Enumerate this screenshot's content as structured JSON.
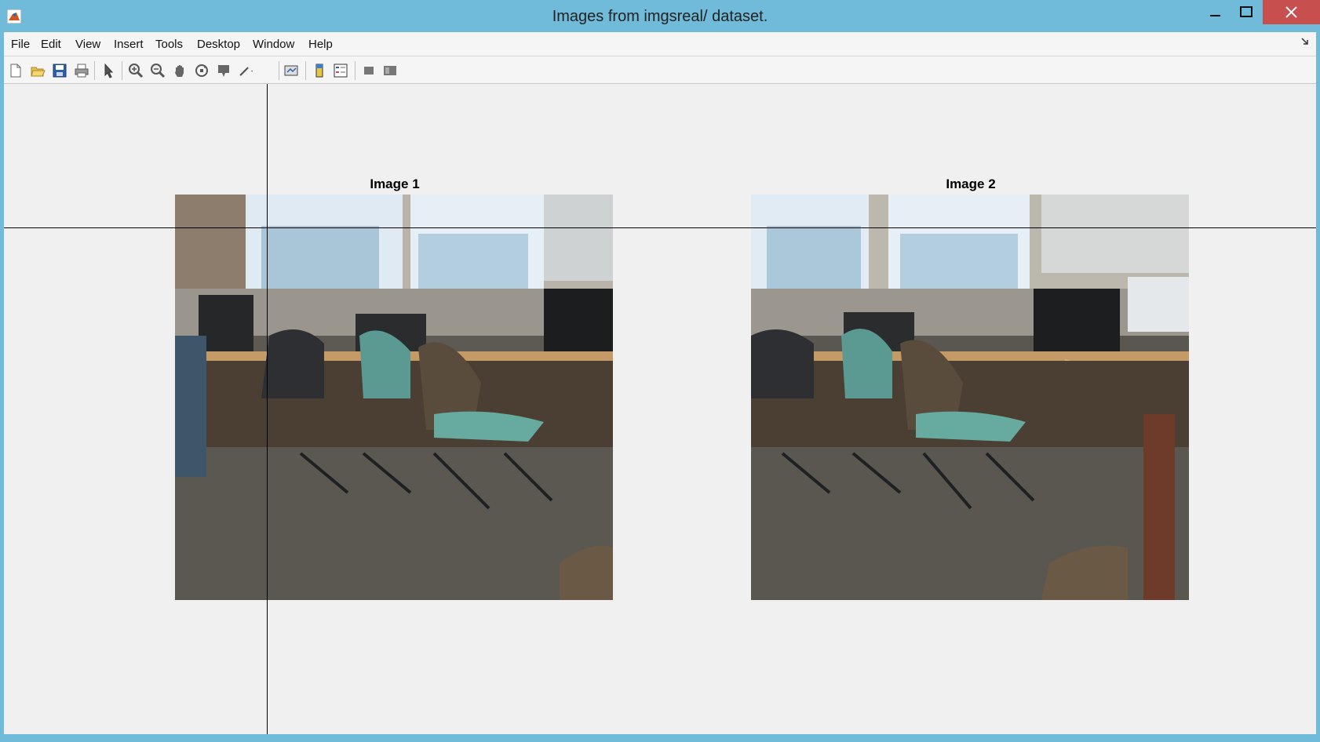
{
  "window": {
    "title": "Images from imgsreal/ dataset."
  },
  "menu": [
    "File",
    "Edit",
    "View",
    "Insert",
    "Tools",
    "Desktop",
    "Window",
    "Help"
  ],
  "toolbar": {
    "icons": [
      "new-figure-icon",
      "open-file-icon",
      "save-icon",
      "print-icon",
      "pointer-icon",
      "zoom-in-icon",
      "zoom-out-icon",
      "pan-icon",
      "rotate-3d-icon",
      "data-cursor-icon",
      "brush-icon",
      "link-plot-icon",
      "colorbar-icon",
      "legend-icon",
      "hide-plot-tools-icon",
      "show-plot-tools-icon"
    ]
  },
  "figure": {
    "axes": [
      {
        "title": "Image 1"
      },
      {
        "title": "Image 2"
      }
    ]
  },
  "colors": {
    "titlebar": "#6fbbd9",
    "close": "#c7504f",
    "figure_bg": "#f0f0f0"
  }
}
